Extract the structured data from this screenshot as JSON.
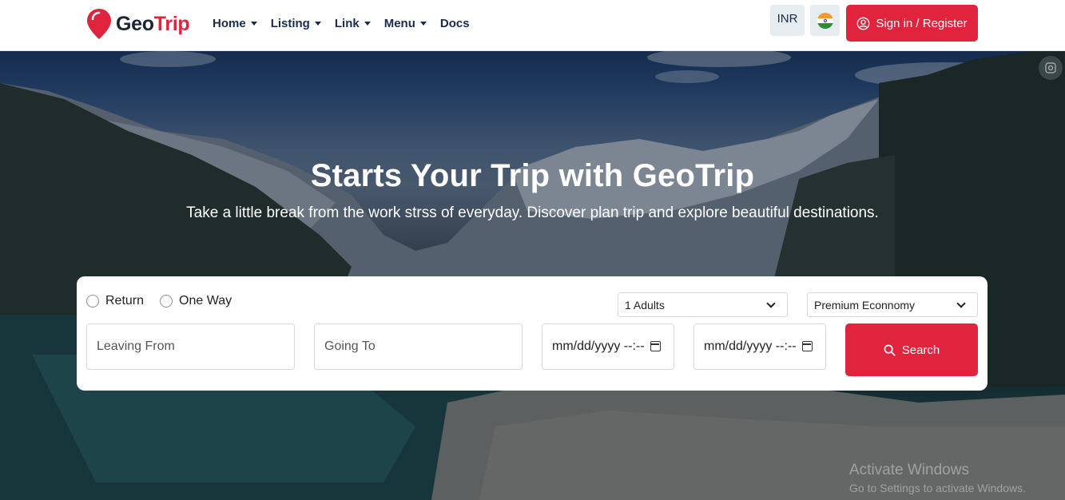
{
  "brand": {
    "name_part1": "Geo",
    "name_part2": "Trip",
    "accent": "#e0243d",
    "dark": "#1c2434"
  },
  "nav": {
    "items": [
      {
        "label": "Home",
        "has_dropdown": true
      },
      {
        "label": "Listing",
        "has_dropdown": true
      },
      {
        "label": "Link",
        "has_dropdown": true
      },
      {
        "label": "Menu",
        "has_dropdown": true
      },
      {
        "label": "Docs",
        "has_dropdown": false
      }
    ],
    "currency": "INR",
    "flag_icon": "india-flag-icon",
    "signin_label": "Sign in / Register",
    "signin_icon": "user-circle-icon"
  },
  "hero": {
    "title": "Starts Your Trip with GeoTrip",
    "subtitle": "Take a little break from the work strss of everyday. Discover plan trip and explore beautiful destinations."
  },
  "search": {
    "trip_types": [
      "Return",
      "One Way"
    ],
    "selected_trip_type": null,
    "passengers": "1 Adults",
    "cabin_class": "Premium Econnomy",
    "leaving_placeholder": "Leaving From",
    "going_placeholder": "Going To",
    "depart_date": "mm/dd/yyyy --:--",
    "return_date": "mm/dd/yyyy --:--",
    "search_label": "Search",
    "search_icon": "search-icon"
  },
  "watermark": {
    "title": "Activate Windows",
    "subtitle": "Go to Settings to activate Windows."
  }
}
